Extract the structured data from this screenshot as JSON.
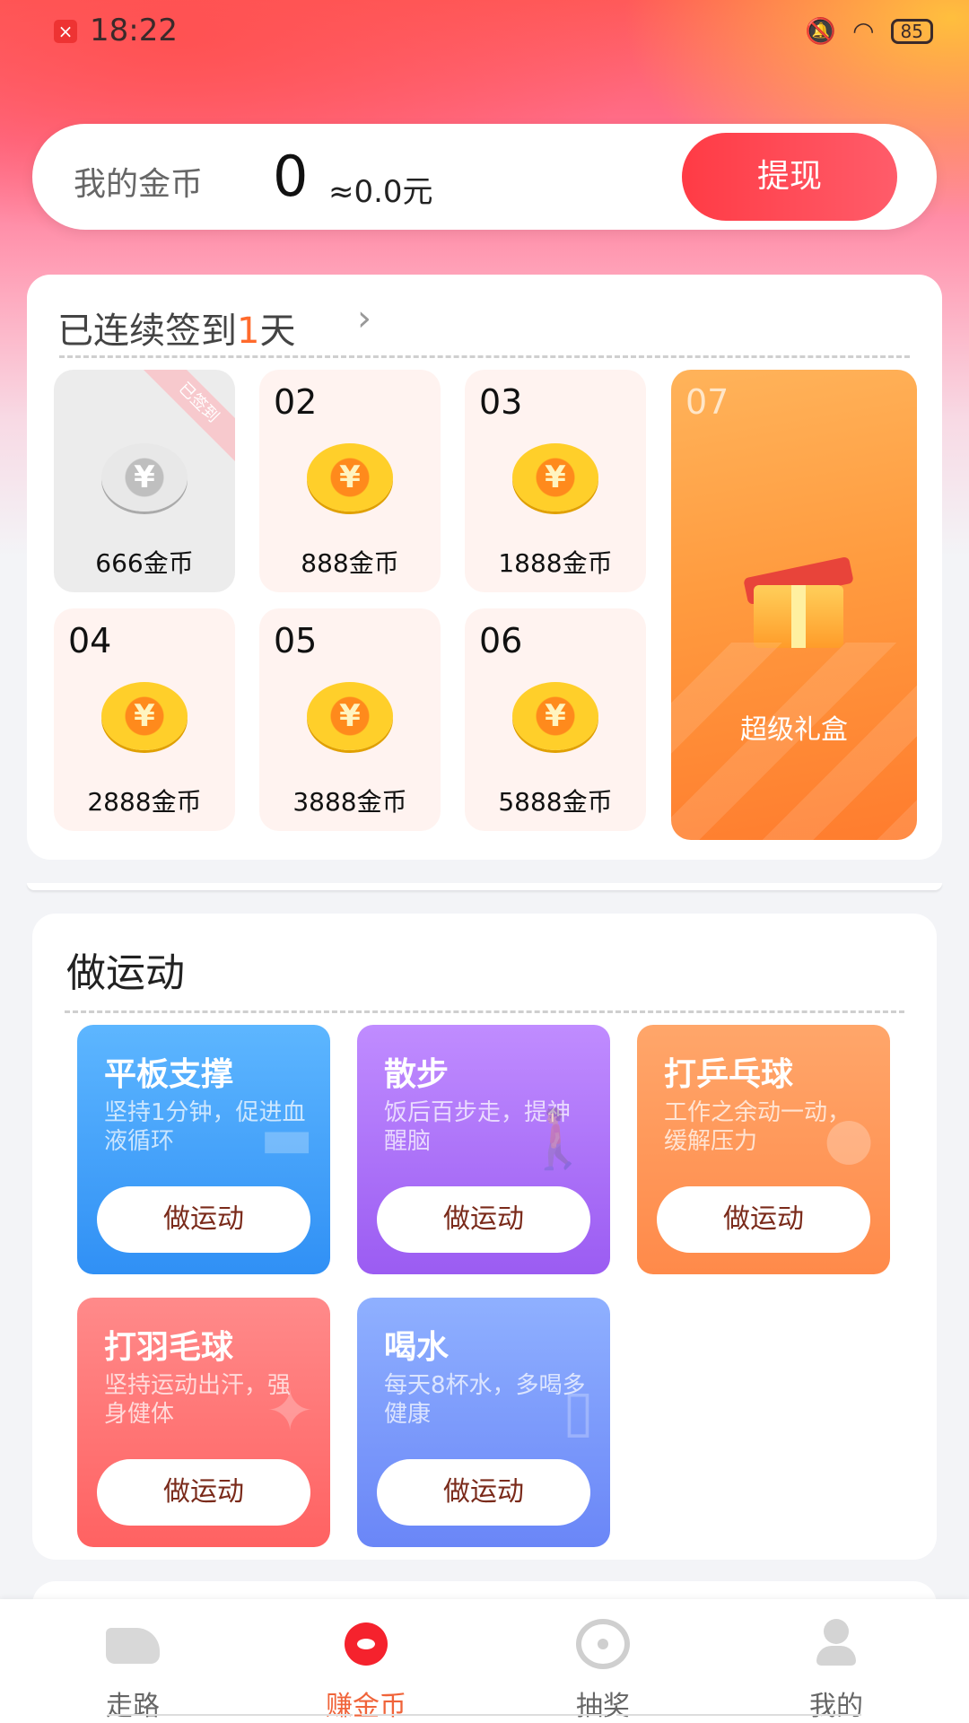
{
  "status": {
    "time": "18:22",
    "battery": "85"
  },
  "coins": {
    "label": "我的金币",
    "value": "0",
    "approx": "≈0.0元",
    "withdraw": "提现"
  },
  "signin": {
    "title_prefix": "已连续签到",
    "days_count": "1",
    "title_suffix": "天",
    "chevron": "›",
    "days": [
      {
        "num": "",
        "amount": "666金币",
        "status": "已签到",
        "coin": "¥"
      },
      {
        "num": "02",
        "amount": "888金币",
        "coin": "¥"
      },
      {
        "num": "03",
        "amount": "1888金币",
        "coin": "¥"
      },
      {
        "num": "04",
        "amount": "2888金币",
        "coin": "¥"
      },
      {
        "num": "05",
        "amount": "3888金币",
        "coin": "¥"
      },
      {
        "num": "06",
        "amount": "5888金币",
        "coin": "¥"
      }
    ],
    "day7": {
      "num": "07",
      "label": "超级礼盒"
    }
  },
  "exercise": {
    "title": "做运动",
    "items": [
      {
        "name": "平板支撑",
        "desc": "坚持1分钟，促进血液循环",
        "button": "做运动",
        "icon": "plank-icon",
        "glyph": "▬"
      },
      {
        "name": "散步",
        "desc": "饭后百步走，提神醒脑",
        "button": "做运动",
        "icon": "walking-icon",
        "glyph": "🚶"
      },
      {
        "name": "打乒乓球",
        "desc": "工作之余动一动，缓解压力",
        "button": "做运动",
        "icon": "ping-pong-icon",
        "glyph": "●"
      },
      {
        "name": "打羽毛球",
        "desc": "坚持运动出汗，强身健体",
        "button": "做运动",
        "icon": "badminton-icon",
        "glyph": "✦"
      },
      {
        "name": "喝水",
        "desc": "每天8杯水，多喝多健康",
        "button": "做运动",
        "icon": "water-glass-icon",
        "glyph": "▯"
      }
    ]
  },
  "nav": [
    {
      "label": "走路",
      "icon": "sneaker-icon",
      "active": false
    },
    {
      "label": "赚金币",
      "icon": "coin-eye-icon",
      "active": true
    },
    {
      "label": "抽奖",
      "icon": "wheel-icon",
      "active": false
    },
    {
      "label": "我的",
      "icon": "person-icon",
      "active": false
    }
  ],
  "colors": {
    "accent": "#ff3b45",
    "highlight": "#ff6a2c",
    "nav_active": "#f0643a"
  }
}
